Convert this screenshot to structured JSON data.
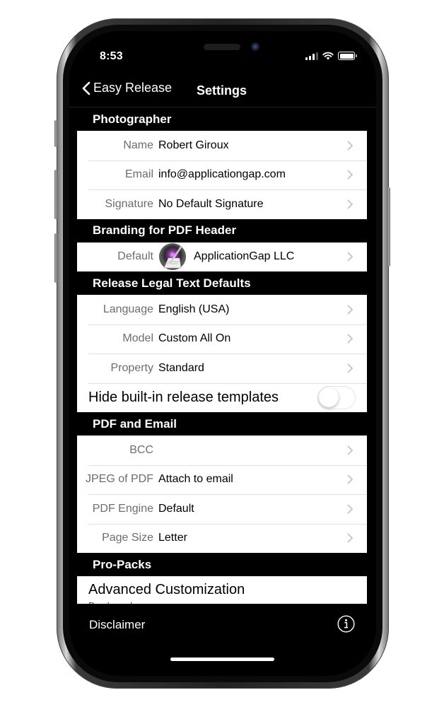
{
  "status_bar": {
    "time": "8:53",
    "icons": [
      "cellular-signal-icon",
      "wifi-icon",
      "battery-icon"
    ]
  },
  "nav": {
    "back_label": "Easy Release",
    "title": "Settings"
  },
  "sections": {
    "photographer": {
      "header": "Photographer",
      "rows": [
        {
          "label": "Name",
          "value": "Robert Giroux"
        },
        {
          "label": "Email",
          "value": "info@applicationgap.com"
        },
        {
          "label": "Signature",
          "value": "No Default Signature"
        }
      ]
    },
    "branding": {
      "header": "Branding for PDF Header",
      "rows": [
        {
          "label": "Default",
          "value": "ApplicationGap LLC",
          "icon": "app-logo-icon"
        }
      ]
    },
    "legal": {
      "header": "Release Legal Text Defaults",
      "rows": [
        {
          "label": "Language",
          "value": "English (USA)"
        },
        {
          "label": "Model",
          "value": "Custom All On"
        },
        {
          "label": "Property",
          "value": "Standard"
        }
      ],
      "toggle": {
        "label": "Hide built-in release templates",
        "on": false
      }
    },
    "pdf_email": {
      "header": "PDF and Email",
      "rows": [
        {
          "label": "BCC",
          "value": ""
        },
        {
          "label": "JPEG of PDF",
          "value": "Attach to email"
        },
        {
          "label": "PDF Engine",
          "value": "Default"
        },
        {
          "label": "Page Size",
          "value": "Letter"
        }
      ]
    },
    "propacks": {
      "header": "Pro-Packs",
      "rows": [
        {
          "title": "Advanced Customization",
          "subtitle": "Purchased"
        }
      ]
    }
  },
  "toolbar": {
    "disclaimer_label": "Disclaimer",
    "info_icon": "info-icon"
  },
  "colors": {
    "background": "#000000",
    "cell_background": "#ffffff",
    "label_gray": "#6d6d6d",
    "chevron_gray": "#c4c4c8"
  }
}
